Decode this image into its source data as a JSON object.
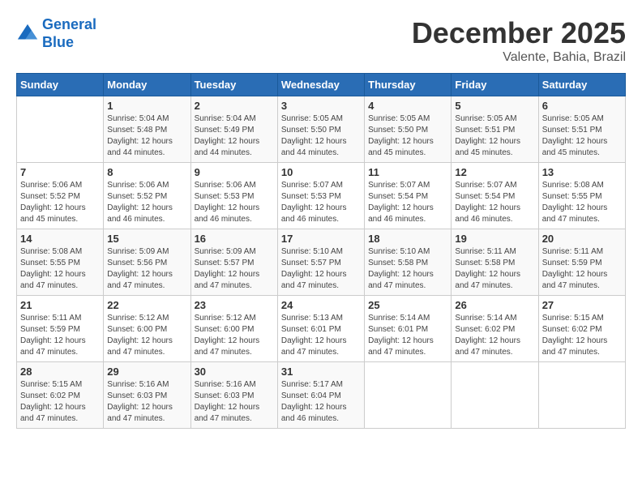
{
  "header": {
    "logo_line1": "General",
    "logo_line2": "Blue",
    "month": "December 2025",
    "location": "Valente, Bahia, Brazil"
  },
  "days_of_week": [
    "Sunday",
    "Monday",
    "Tuesday",
    "Wednesday",
    "Thursday",
    "Friday",
    "Saturday"
  ],
  "weeks": [
    [
      {
        "day": "",
        "info": ""
      },
      {
        "day": "1",
        "info": "Sunrise: 5:04 AM\nSunset: 5:48 PM\nDaylight: 12 hours\nand 44 minutes."
      },
      {
        "day": "2",
        "info": "Sunrise: 5:04 AM\nSunset: 5:49 PM\nDaylight: 12 hours\nand 44 minutes."
      },
      {
        "day": "3",
        "info": "Sunrise: 5:05 AM\nSunset: 5:50 PM\nDaylight: 12 hours\nand 44 minutes."
      },
      {
        "day": "4",
        "info": "Sunrise: 5:05 AM\nSunset: 5:50 PM\nDaylight: 12 hours\nand 45 minutes."
      },
      {
        "day": "5",
        "info": "Sunrise: 5:05 AM\nSunset: 5:51 PM\nDaylight: 12 hours\nand 45 minutes."
      },
      {
        "day": "6",
        "info": "Sunrise: 5:05 AM\nSunset: 5:51 PM\nDaylight: 12 hours\nand 45 minutes."
      }
    ],
    [
      {
        "day": "7",
        "info": "Sunrise: 5:06 AM\nSunset: 5:52 PM\nDaylight: 12 hours\nand 45 minutes."
      },
      {
        "day": "8",
        "info": "Sunrise: 5:06 AM\nSunset: 5:52 PM\nDaylight: 12 hours\nand 46 minutes."
      },
      {
        "day": "9",
        "info": "Sunrise: 5:06 AM\nSunset: 5:53 PM\nDaylight: 12 hours\nand 46 minutes."
      },
      {
        "day": "10",
        "info": "Sunrise: 5:07 AM\nSunset: 5:53 PM\nDaylight: 12 hours\nand 46 minutes."
      },
      {
        "day": "11",
        "info": "Sunrise: 5:07 AM\nSunset: 5:54 PM\nDaylight: 12 hours\nand 46 minutes."
      },
      {
        "day": "12",
        "info": "Sunrise: 5:07 AM\nSunset: 5:54 PM\nDaylight: 12 hours\nand 46 minutes."
      },
      {
        "day": "13",
        "info": "Sunrise: 5:08 AM\nSunset: 5:55 PM\nDaylight: 12 hours\nand 47 minutes."
      }
    ],
    [
      {
        "day": "14",
        "info": "Sunrise: 5:08 AM\nSunset: 5:55 PM\nDaylight: 12 hours\nand 47 minutes."
      },
      {
        "day": "15",
        "info": "Sunrise: 5:09 AM\nSunset: 5:56 PM\nDaylight: 12 hours\nand 47 minutes."
      },
      {
        "day": "16",
        "info": "Sunrise: 5:09 AM\nSunset: 5:57 PM\nDaylight: 12 hours\nand 47 minutes."
      },
      {
        "day": "17",
        "info": "Sunrise: 5:10 AM\nSunset: 5:57 PM\nDaylight: 12 hours\nand 47 minutes."
      },
      {
        "day": "18",
        "info": "Sunrise: 5:10 AM\nSunset: 5:58 PM\nDaylight: 12 hours\nand 47 minutes."
      },
      {
        "day": "19",
        "info": "Sunrise: 5:11 AM\nSunset: 5:58 PM\nDaylight: 12 hours\nand 47 minutes."
      },
      {
        "day": "20",
        "info": "Sunrise: 5:11 AM\nSunset: 5:59 PM\nDaylight: 12 hours\nand 47 minutes."
      }
    ],
    [
      {
        "day": "21",
        "info": "Sunrise: 5:11 AM\nSunset: 5:59 PM\nDaylight: 12 hours\nand 47 minutes."
      },
      {
        "day": "22",
        "info": "Sunrise: 5:12 AM\nSunset: 6:00 PM\nDaylight: 12 hours\nand 47 minutes."
      },
      {
        "day": "23",
        "info": "Sunrise: 5:12 AM\nSunset: 6:00 PM\nDaylight: 12 hours\nand 47 minutes."
      },
      {
        "day": "24",
        "info": "Sunrise: 5:13 AM\nSunset: 6:01 PM\nDaylight: 12 hours\nand 47 minutes."
      },
      {
        "day": "25",
        "info": "Sunrise: 5:14 AM\nSunset: 6:01 PM\nDaylight: 12 hours\nand 47 minutes."
      },
      {
        "day": "26",
        "info": "Sunrise: 5:14 AM\nSunset: 6:02 PM\nDaylight: 12 hours\nand 47 minutes."
      },
      {
        "day": "27",
        "info": "Sunrise: 5:15 AM\nSunset: 6:02 PM\nDaylight: 12 hours\nand 47 minutes."
      }
    ],
    [
      {
        "day": "28",
        "info": "Sunrise: 5:15 AM\nSunset: 6:02 PM\nDaylight: 12 hours\nand 47 minutes."
      },
      {
        "day": "29",
        "info": "Sunrise: 5:16 AM\nSunset: 6:03 PM\nDaylight: 12 hours\nand 47 minutes."
      },
      {
        "day": "30",
        "info": "Sunrise: 5:16 AM\nSunset: 6:03 PM\nDaylight: 12 hours\nand 47 minutes."
      },
      {
        "day": "31",
        "info": "Sunrise: 5:17 AM\nSunset: 6:04 PM\nDaylight: 12 hours\nand 46 minutes."
      },
      {
        "day": "",
        "info": ""
      },
      {
        "day": "",
        "info": ""
      },
      {
        "day": "",
        "info": ""
      }
    ]
  ]
}
